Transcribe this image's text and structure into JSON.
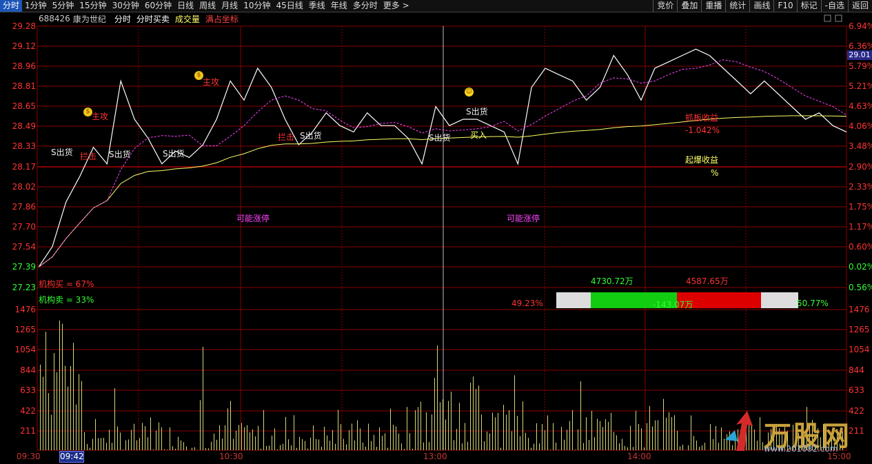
{
  "toolbar": {
    "tabs": [
      "分时",
      "1分钟",
      "5分钟",
      "15分钟",
      "30分钟",
      "60分钟",
      "日线",
      "周线",
      "月线",
      "10分钟",
      "45日线",
      "季线",
      "年线",
      "多分时",
      "更多 >"
    ],
    "right_buttons": [
      "竞价",
      "叠加",
      "重播",
      "统计",
      "画线",
      "F10",
      "标记",
      "-自选",
      "返回"
    ]
  },
  "stock": {
    "code": "688426",
    "name": "康为世纪",
    "chart_label": "分时",
    "mode1": "分时买卖",
    "mode2": "成交量",
    "mode3": "满占坐标"
  },
  "price_axis": {
    "left": [
      "29.28",
      "29.12",
      "28.96",
      "28.81",
      "28.65",
      "28.49",
      "28.33",
      "28.17",
      "28.02",
      "27.86",
      "27.70",
      "27.54",
      "27.39",
      "27.23"
    ],
    "right": [
      "6.94%",
      "6.36%",
      "5.79%",
      "5.21%",
      "4.63%",
      "4.06%",
      "3.48%",
      "2.90%",
      "2.33%",
      "1.75%",
      "1.17%",
      "0.60%",
      "0.02%",
      "0.56%"
    ],
    "current_price": "29.01"
  },
  "volume_axis": {
    "labels": [
      "1476",
      "1265",
      "1054",
      "844",
      "633",
      "422",
      "211"
    ]
  },
  "time_axis": {
    "labels": [
      "09:30",
      "10:30",
      "13:00",
      "14:00",
      "15:00"
    ],
    "selected": "09:42"
  },
  "annotations": {
    "zhugong": "主攻",
    "zhujiao": "主攻",
    "lanjie": "拦击",
    "lanjie2": "拦击",
    "s_out": "S出货",
    "s_out2": "S出货",
    "s_out3": "S出货",
    "s_out4": "S出货",
    "s_out5": "S出货",
    "s_out6": "S出货",
    "buy": "买入",
    "maybe_limit_up": "可能涨停",
    "grab_profit_label": "抓板收益",
    "grab_profit_value": "-1.042%",
    "burst_profit_label": "起爆收益",
    "burst_profit_value": "%"
  },
  "institution": {
    "buy": "机构买 = 67%",
    "sell": "机构卖 = 33%"
  },
  "flow": {
    "in": "4730.72万",
    "out": "4587.65万",
    "net": "-143.07万",
    "left_pct": "49.23%",
    "right_pct": "50.77%"
  },
  "watermark": {
    "brand": "万股网",
    "url": "www.201082.com"
  },
  "colors": {
    "price_line": "#ffffff",
    "avg_line": "#ffff66",
    "ma_line": "#ff44ff",
    "grid": "#8b0000",
    "up": "#ff3333",
    "down": "#33ff33"
  },
  "chart_data": {
    "type": "line",
    "series": [
      {
        "name": "",
        "values": [
          27.39,
          27.55,
          27.9,
          28.1,
          28.33,
          28.2,
          28.85,
          28.55,
          28.4,
          28.2,
          28.3,
          28.25,
          28.35,
          28.55,
          28.85,
          28.7,
          28.95,
          28.8,
          28.55,
          28.35,
          28.45,
          28.6,
          28.5,
          28.45,
          28.6,
          28.5,
          28.5,
          28.4,
          28.2,
          28.65,
          28.5,
          28.55,
          28.55,
          28.5,
          28.45,
          28.2,
          28.8,
          28.95,
          28.9,
          28.85,
          28.7,
          28.8,
          29.05,
          28.9,
          28.7,
          28.95,
          29.0,
          29.05,
          29.1,
          29.05,
          28.95,
          28.85,
          28.75,
          28.85,
          28.75,
          28.65,
          28.55,
          28.6,
          28.5,
          28.45
        ]
      }
    ]
  }
}
